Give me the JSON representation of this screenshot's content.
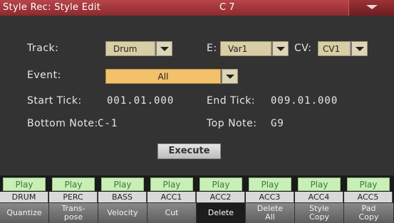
{
  "titlebar": {
    "title": "Style Rec: Style Edit",
    "chord": "C 7",
    "menu_icon": "chevron-down"
  },
  "form": {
    "track_label": "Track:",
    "track_value": "Drum",
    "e_label": "E:",
    "e_value": "Var1",
    "cv_label": "CV:",
    "cv_value": "CV1",
    "event_label": "Event:",
    "event_value": "All",
    "start_tick_label": "Start Tick:",
    "start_tick_value": "001.01.000",
    "end_tick_label": "End Tick:",
    "end_tick_value": "009.01.000",
    "bottom_note_label": "Bottom Note:",
    "bottom_note_value": "C-1",
    "top_note_label": "Top Note:",
    "top_note_value": "G9",
    "execute_label": "Execute"
  },
  "tracks": [
    {
      "play": "Play",
      "name": "DRUM"
    },
    {
      "play": "Play",
      "name": "PERC"
    },
    {
      "play": "Play",
      "name": "BASS"
    },
    {
      "play": "Play",
      "name": "ACC1"
    },
    {
      "play": "Play",
      "name": "ACC2"
    },
    {
      "play": "Play",
      "name": "ACC3"
    },
    {
      "play": "Play",
      "name": "ACC4"
    },
    {
      "play": "Play",
      "name": "ACC5"
    }
  ],
  "tabs": [
    {
      "line1": "Quantize",
      "line2": ""
    },
    {
      "line1": "Trans-",
      "line2": "pose"
    },
    {
      "line1": "Velocity",
      "line2": ""
    },
    {
      "line1": "Cut",
      "line2": ""
    },
    {
      "line1": "Delete",
      "line2": "",
      "active": true
    },
    {
      "line1": "Delete",
      "line2": "All"
    },
    {
      "line1": "Style",
      "line2": "Copy"
    },
    {
      "line1": "Pad",
      "line2": "Copy"
    }
  ],
  "colors": {
    "titlebar": "#9c3338",
    "play_bg": "#c9efb7",
    "event_highlight": "#f3c06b"
  }
}
